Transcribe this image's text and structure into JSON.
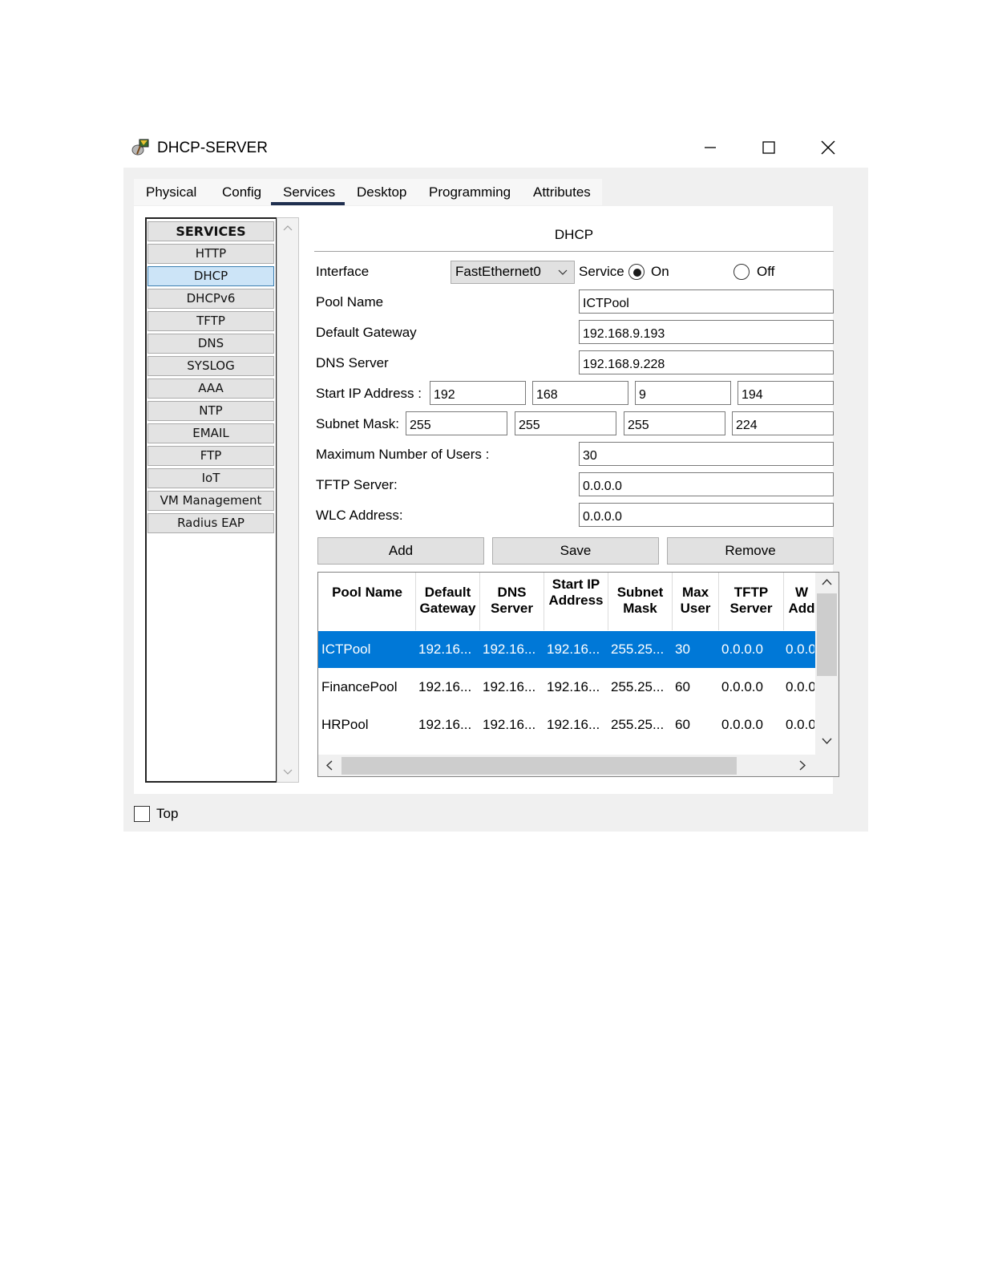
{
  "window": {
    "title": "DHCP-SERVER",
    "icons": {
      "app": "dhcp-server-icon",
      "minimize": "minimize-icon",
      "maximize": "maximize-icon",
      "close": "close-icon"
    }
  },
  "tabs": [
    "Physical",
    "Config",
    "Services",
    "Desktop",
    "Programming",
    "Attributes"
  ],
  "active_tab": "Services",
  "services": {
    "header": "SERVICES",
    "items": [
      "HTTP",
      "DHCP",
      "DHCPv6",
      "TFTP",
      "DNS",
      "SYSLOG",
      "AAA",
      "NTP",
      "EMAIL",
      "FTP",
      "IoT",
      "VM Management",
      "Radius EAP"
    ],
    "selected": "DHCP"
  },
  "dhcp": {
    "header": "DHCP",
    "interface_label": "Interface",
    "interface_value": "FastEthernet0",
    "service_label": "Service",
    "on_label": "On",
    "off_label": "Off",
    "service_state": "On",
    "pool_name_label": "Pool Name",
    "pool_name": "ICTPool",
    "gateway_label": "Default Gateway",
    "gateway": "192.168.9.193",
    "dns_label": "DNS Server",
    "dns": "192.168.9.228",
    "start_ip_label": "Start IP Address :",
    "start_ip": [
      "192",
      "168",
      "9",
      "194"
    ],
    "subnet_label": "Subnet Mask:",
    "subnet": [
      "255",
      "255",
      "255",
      "224"
    ],
    "max_users_label": "Maximum Number of Users :",
    "max_users": "30",
    "tftp_label": "TFTP Server:",
    "tftp": "0.0.0.0",
    "wlc_label": "WLC Address:",
    "wlc": "0.0.0.0",
    "buttons": {
      "add": "Add",
      "save": "Save",
      "remove": "Remove"
    }
  },
  "table": {
    "columns": [
      "Pool Name",
      "Default Gateway",
      "DNS Server",
      "Start IP Address",
      "Subnet Mask",
      "Max User",
      "TFTP Server",
      "W Add"
    ],
    "rows": [
      [
        "ICTPool",
        "192.16...",
        "192.16...",
        "192.16...",
        "255.25...",
        "30",
        "0.0.0.0",
        "0.0.0"
      ],
      [
        "FinancePool",
        "192.16...",
        "192.16...",
        "192.16...",
        "255.25...",
        "60",
        "0.0.0.0",
        "0.0.0"
      ],
      [
        "HRPool",
        "192.16...",
        "192.16...",
        "192.16...",
        "255.25...",
        "60",
        "0.0.0.0",
        "0.0.0"
      ]
    ],
    "selected_row": 0
  },
  "footer": {
    "top_label": "Top",
    "top_checked": false
  },
  "colors": {
    "selection": "#0078d7",
    "tab_underline": "#1f2f4f",
    "service_selected": "#cce4f7"
  }
}
